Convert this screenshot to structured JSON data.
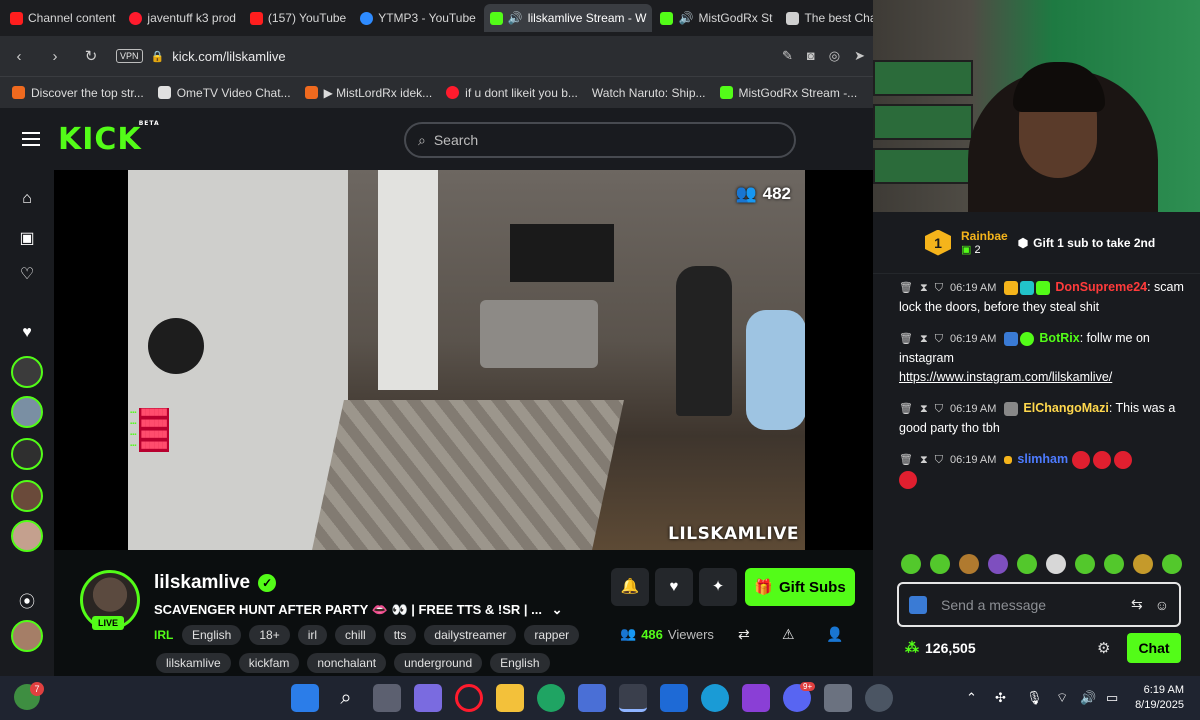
{
  "browser": {
    "tabs": [
      {
        "label": "Channel content",
        "icon": "youtube-icon"
      },
      {
        "label": "javentuff k3 prod",
        "icon": "opera-icon"
      },
      {
        "label": "(157) YouTube",
        "icon": "youtube-icon"
      },
      {
        "label": "YTMP3 - YouTube",
        "icon": "ytmp3-icon"
      },
      {
        "label": "lilskamlive Stream - W",
        "icon": "kick-icon",
        "active": true
      },
      {
        "label": "MistGodRx St",
        "icon": "kick-icon"
      },
      {
        "label": "The best ChatB",
        "icon": "chatbot-icon"
      }
    ],
    "url": "kick.com/lilskamlive",
    "vpn": "VPN",
    "bookmarks": [
      {
        "label": "Discover the top str...",
        "icon": "orange-icon"
      },
      {
        "label": "OmeTV Video Chat...",
        "icon": "ometv-icon"
      },
      {
        "label": "▶ MistLordRx idek...",
        "icon": "orange-icon"
      },
      {
        "label": "if u dont likeit you b...",
        "icon": "opera-icon"
      },
      {
        "label": "Watch Naruto: Ship...",
        "icon": "blank-icon"
      },
      {
        "label": "MistGodRx Stream -...",
        "icon": "kick-icon"
      }
    ]
  },
  "kick": {
    "logo": "KICK",
    "beta": "BETA",
    "search_placeholder": "Search"
  },
  "video": {
    "viewer_count": "482",
    "watermark": "LILSKAMLIVE"
  },
  "stream": {
    "channel": "lilskamlive",
    "title": "SCAVENGER HUNT AFTER PARTY 👄 👀 | FREE TTS & !SR | ...",
    "category": "IRL",
    "tags_row1": [
      "English",
      "18+",
      "irl",
      "chill",
      "tts",
      "dailystreamer",
      "rapper"
    ],
    "tags_row2": [
      "lilskamlive",
      "kickfam",
      "nonchalant",
      "underground",
      "English"
    ],
    "live": "LIVE",
    "viewers": "486",
    "viewers_label": "Viewers",
    "gift_subs": "Gift Subs"
  },
  "chat": {
    "top_gifter": {
      "rank": "1",
      "name": "Rainbae",
      "count": "2"
    },
    "gift_cta": "Gift 1 sub to take 2nd",
    "messages": [
      {
        "time": "06:19 AM",
        "user": "DonSupreme24",
        "user_color": "#ff3b3b",
        "text": ": scam lock the doors, before they steal shit"
      },
      {
        "time": "06:19 AM",
        "user": "BotRix",
        "user_color": "#53fc18",
        "text": ": follw me on instagram",
        "link": "https://www.instagram.com/lilskamlive/"
      },
      {
        "time": "06:19 AM",
        "user": "ElChangoMazi",
        "user_color": "#ffd84d",
        "text": ": This was a good party tho tbh"
      },
      {
        "time": "06:19 AM",
        "user": "slimham",
        "user_color": "#4d7bff",
        "text": ""
      }
    ],
    "input_placeholder": "Send a message",
    "points": "126,505",
    "send": "Chat"
  },
  "taskbar": {
    "time": "6:19 AM",
    "date": "8/19/2025",
    "notif_count": "7",
    "discord_badge": "9+"
  },
  "colors": {
    "accent": "#53fc18",
    "bg": "#0b0e0f",
    "panel": "#191b1f"
  }
}
